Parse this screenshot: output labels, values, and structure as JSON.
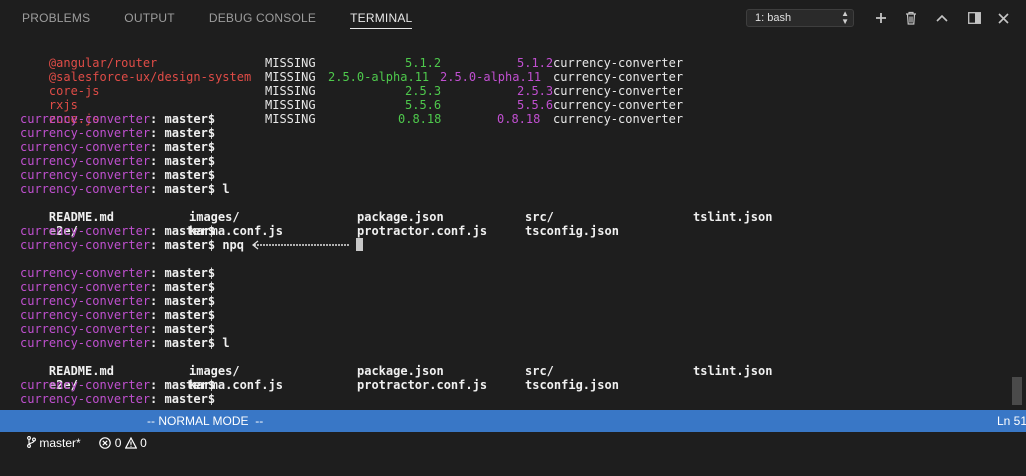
{
  "tabs": [
    "PROBLEMS",
    "OUTPUT",
    "DEBUG CONSOLE",
    "TERMINAL"
  ],
  "terminal_select": "1: bash",
  "icons": [
    "plus-icon",
    "trash-icon",
    "chevron-up-icon",
    "split-icon",
    "close-icon"
  ],
  "missing_table": [
    [
      "@angular/router",
      "MISSING",
      "5.1.2",
      "5.1.2",
      "currency-converter"
    ],
    [
      "@salesforce-ux/design-system",
      "MISSING",
      "2.5.0-alpha.11",
      "2.5.0-alpha.11",
      "currency-converter"
    ],
    [
      "core-js",
      "MISSING",
      "2.5.3",
      "2.5.3",
      "currency-converter"
    ],
    [
      "rxjs",
      "MISSING",
      "5.5.6",
      "5.5.6",
      "currency-converter"
    ],
    [
      "zone.js",
      "MISSING",
      "0.8.18",
      "0.8.18",
      "currency-converter"
    ]
  ],
  "prompt": {
    "dir": "currency-converter",
    "branch": "master"
  },
  "ls_output": [
    [
      "README.md",
      "images/",
      "package.json",
      "src/",
      "tslint.json"
    ],
    [
      "e2e/",
      "karma.conf.js",
      "protractor.conf.js",
      "tsconfig.json",
      ""
    ]
  ],
  "commands": {
    "l": "l",
    "npq": "npq"
  },
  "status": {
    "branch": "master*",
    "errors": "0",
    "warnings": "0",
    "mode": "-- NORMAL MODE  --",
    "position": "Ln 51"
  },
  "colors": {
    "statusbar": "#3977c6",
    "package_name": "#e04c47",
    "version_wanted": "#4ec94c",
    "version_latest": "#c04fd0",
    "prompt": "#c050d0"
  }
}
